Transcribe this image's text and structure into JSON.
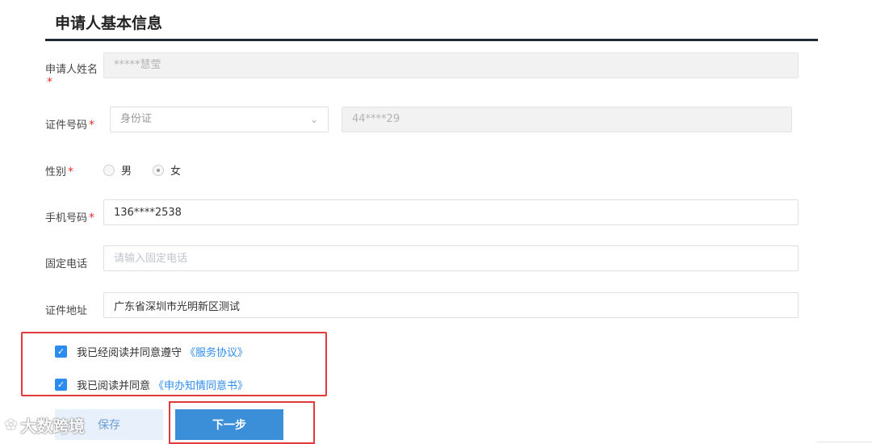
{
  "section": {
    "title": "申请人基本信息"
  },
  "form": {
    "name": {
      "label": "申请人姓名",
      "required_mark": "*",
      "value": "*****慧莹"
    },
    "id_number": {
      "label": "证件号码",
      "required_mark": "*",
      "type_value": "身份证",
      "number_value": "44****29",
      "arrow_icon": "chevron-down"
    },
    "gender": {
      "label": "性别",
      "required_mark": "*",
      "options": [
        "男",
        "女"
      ],
      "selected": "女"
    },
    "mobile": {
      "label": "手机号码",
      "required_mark": "*",
      "value": "136****2538"
    },
    "landline": {
      "label": "固定电话",
      "placeholder": "请输入固定电话"
    },
    "address": {
      "label": "证件地址",
      "value": "广东省深圳市光明新区测试"
    }
  },
  "agreements": [
    {
      "text": "我已经阅读并同意遵守",
      "link": "《服务协议》",
      "checked": true
    },
    {
      "text": "我已阅读并同意",
      "link": "《申办知情同意书》",
      "checked": true
    }
  ],
  "buttons": {
    "save": "保存",
    "next": "下一步"
  },
  "watermark": {
    "text": "大数跨境"
  },
  "colors": {
    "accent": "#2d8cf0",
    "button": "#3b8fd9",
    "highlight": "#e23a3a",
    "required": "#e0312d"
  }
}
